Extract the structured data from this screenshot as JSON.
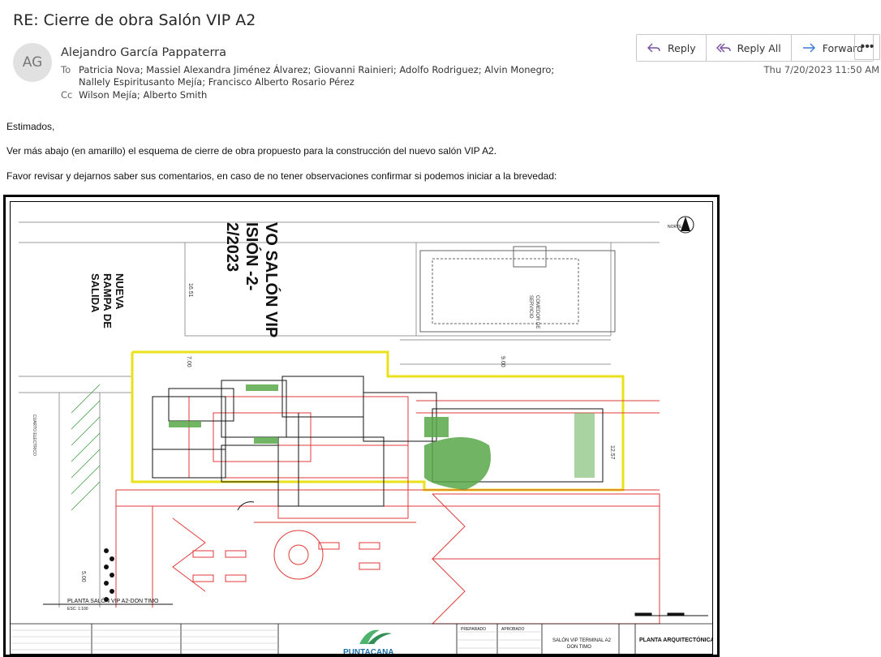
{
  "email": {
    "subject": "RE: Cierre de obra Salón VIP A2",
    "avatar_initials": "AG",
    "sender": "Alejandro García Pappaterra",
    "to_label": "To",
    "to_line1": "Patricia Nova; Massiel Alexandra Jiménez Álvarez; Giovanni Rainieri; Adolfo Rodriguez; Alvin Monegro;",
    "to_line2": "Nallely Espiritusanto Mejía; Francisco Alberto Rosario Pérez",
    "cc_label": "Cc",
    "cc": "Wilson Mejía; Alberto Smith",
    "timestamp": "Thu 7/20/2023 11:50 AM",
    "greeting": "Estimados,",
    "paragraph1": "Ver más abajo (en amarillo) el esquema de cierre de obra propuesto para la construcción del nuevo salón VIP A2.",
    "paragraph2": "Favor revisar y dejarnos saber sus comentarios, en caso de no tener observaciones confirmar si podemos iniciar a la brevedad:"
  },
  "actions": {
    "reply": "Reply",
    "reply_all": "Reply All",
    "forward": "Forward",
    "more": "•••"
  },
  "plan": {
    "title_rotated_1": "VO SALÓN VIP",
    "title_rotated_2": "ISIÓN -2-",
    "title_rotated_3": "2/2023",
    "ramp_label_1": "NUEVA",
    "ramp_label_2": "RAMPA DE",
    "ramp_label_3": "SALIDA",
    "comedor_1": "COMEDOR DE",
    "comedor_2": "SERVICIO",
    "north": "NORTE",
    "dim_1": "16.51",
    "dim_2": "7.00",
    "dim_3": "9.00",
    "dim_4": "12.57",
    "dim_5": "5.00",
    "cuarto_label": "CUARTO ELECTRICO",
    "plan_title": "PLANTA SALÓN VIP A2-DON TIMO",
    "plan_scale": "ESC: 1:100",
    "brand": "PUNTACANA",
    "tb_preparado": "PREPARADO",
    "tb_aprobado": "APROBADO",
    "tb_project": "SALÓN VIP TERMINAL A2",
    "tb_project2": "DON TIMO",
    "tb_sheet": "PLANTA ARQUITECTÓNICA"
  }
}
